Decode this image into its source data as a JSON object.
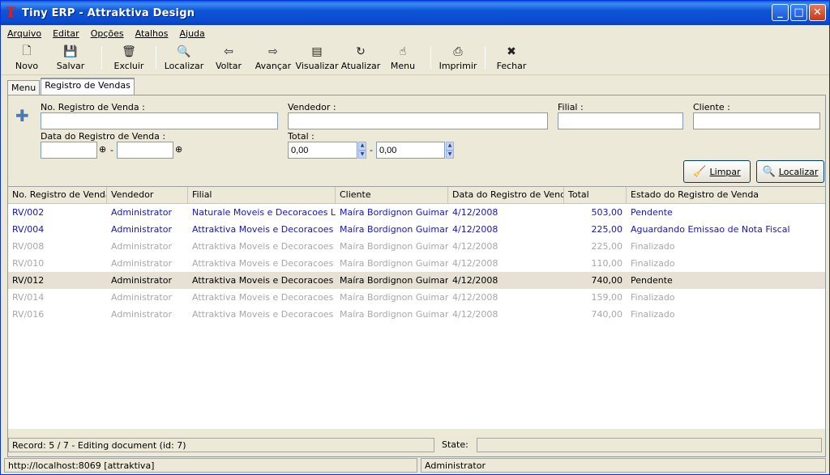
{
  "window": {
    "title": "Tiny ERP - Attraktiva Design",
    "logo_letter": "T",
    "controls": {
      "minimize": "_",
      "maximize": "□",
      "close": "✕"
    }
  },
  "menubar": [
    "Arquivo",
    "Editar",
    "Opções",
    "Atalhos",
    "Ajuda"
  ],
  "toolbar": [
    {
      "label": "Novo",
      "icon": "new-document-icon",
      "glyph": "🗋"
    },
    {
      "label": "Salvar",
      "icon": "floppy-disk-icon",
      "glyph": "💾"
    },
    {
      "label": "Excluir",
      "icon": "trash-icon",
      "glyph": "🗑"
    },
    {
      "label": "Localizar",
      "icon": "find-icon",
      "glyph": "🔍"
    },
    {
      "label": "Voltar",
      "icon": "arrow-left-icon",
      "glyph": "⇦"
    },
    {
      "label": "Avançar",
      "icon": "arrow-right-icon",
      "glyph": "⇨"
    },
    {
      "label": "Visualizar",
      "icon": "form-view-icon",
      "glyph": "▤"
    },
    {
      "label": "Atualizar",
      "icon": "reload-icon",
      "glyph": "↻"
    },
    {
      "label": "Menu",
      "icon": "hand-menu-icon",
      "glyph": "☝"
    },
    {
      "label": "Imprimir",
      "icon": "printer-icon",
      "glyph": "⎙"
    },
    {
      "label": "Fechar",
      "icon": "close-icon",
      "glyph": "✖"
    }
  ],
  "tabs": [
    {
      "label": "Menu",
      "active": false
    },
    {
      "label": "Registro de Vendas",
      "active": true
    }
  ],
  "search": {
    "no_registro_label": "No. Registro de Venda :",
    "no_registro_value": "",
    "vendedor_label": "Vendedor :",
    "vendedor_value": "",
    "filial_label": "Filial :",
    "filial_value": "",
    "cliente_label": "Cliente :",
    "cliente_value": "",
    "data_label": "Data do Registro de Venda :",
    "data_from": "",
    "data_to": "",
    "range_dash": "-",
    "total_label": "Total :",
    "total_from": "0,00",
    "total_to": "0,00",
    "limpar_label": "Limpar",
    "localizar_label": "Localizar"
  },
  "grid": {
    "columns": [
      "No. Registro de Venda",
      "Vendedor",
      "Filial",
      "Cliente",
      "Data do Registro de Venda",
      "Total",
      "Estado do Registro de Venda"
    ],
    "rows": [
      {
        "no": "RV/002",
        "vendedor": "Administrator",
        "filial": "Naturale Moveis e Decoracoes Ltda",
        "cliente": "Maíra Bordignon Guimarães",
        "data": "4/12/2008",
        "total": "503,00",
        "estado": "Pendente",
        "style": "blue"
      },
      {
        "no": "RV/004",
        "vendedor": "Administrator",
        "filial": "Attraktiva Moveis e Decoracoes Ltda",
        "cliente": "Maíra Bordignon Guimarães",
        "data": "4/12/2008",
        "total": "225,00",
        "estado": "Aguardando Emissao de Nota Fiscal",
        "style": "blue"
      },
      {
        "no": "RV/008",
        "vendedor": "Administrator",
        "filial": "Attraktiva Moveis e Decoracoes Ltda",
        "cliente": "Maíra Bordignon Guimarães",
        "data": "4/12/2008",
        "total": "225,00",
        "estado": "Finalizado",
        "style": "gray"
      },
      {
        "no": "RV/010",
        "vendedor": "Administrator",
        "filial": "Attraktiva Moveis e Decoracoes Ltda",
        "cliente": "Maíra Bordignon Guimarães",
        "data": "4/12/2008",
        "total": "110,00",
        "estado": "Finalizado",
        "style": "gray"
      },
      {
        "no": "RV/012",
        "vendedor": "Administrator",
        "filial": "Attraktiva Moveis e Decoracoes Ltda",
        "cliente": "Maíra Bordignon Guimarães",
        "data": "4/12/2008",
        "total": "740,00",
        "estado": "Pendente",
        "style": "sel"
      },
      {
        "no": "RV/014",
        "vendedor": "Administrator",
        "filial": "Attraktiva Moveis e Decoracoes Ltda",
        "cliente": "Maíra Bordignon Guimarães",
        "data": "4/12/2008",
        "total": "159,00",
        "estado": "Finalizado",
        "style": "gray"
      },
      {
        "no": "RV/016",
        "vendedor": "Administrator",
        "filial": "Attraktiva Moveis e Decoracoes Ltda",
        "cliente": "Maíra Bordignon Guimarães",
        "data": "4/12/2008",
        "total": "740,00",
        "estado": "Finalizado",
        "style": "gray"
      }
    ]
  },
  "status": {
    "record": "Record: 5 / 7 - Editing document (id: 7)",
    "state_label": "State:",
    "state_value": "",
    "server": "http://localhost:8069 [attraktiva]",
    "user": "Administrator"
  },
  "colors": {
    "active_row_text": "#1414c8",
    "inactive_row_text": "#a8a8a8",
    "selected_row_bg": "#e6e1d4",
    "tab_accent": "#f7a839"
  }
}
